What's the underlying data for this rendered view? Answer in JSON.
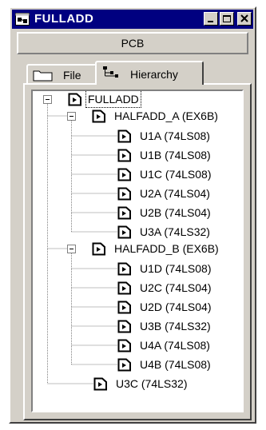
{
  "window": {
    "title": "FULLADD",
    "app_icon": "schematic-app-icon",
    "buttons": [
      "minimize-icon",
      "maximize-icon",
      "close-icon"
    ]
  },
  "pcb_button": {
    "label": "PCB"
  },
  "tabs": [
    {
      "label": "File",
      "icon": "folder-icon",
      "selected": false
    },
    {
      "label": "Hierarchy",
      "icon": "hierarchy-icon",
      "selected": true
    }
  ],
  "tree": {
    "root": {
      "label": "FULLADD",
      "selected": true
    },
    "groups": [
      {
        "label": "HALFADD_A (EX6B)",
        "children": [
          "U1A (74LS08)",
          "U1B (74LS08)",
          "U1C (74LS08)",
          "U2A (74LS04)",
          "U2B (74LS04)",
          "U3A (74LS32)"
        ]
      },
      {
        "label": "HALFADD_B (EX6B)",
        "children": [
          "U1D (74LS08)",
          "U2C (74LS04)",
          "U2D (74LS04)",
          "U3B (74LS32)",
          "U4A (74LS08)",
          "U4B (74LS08)"
        ]
      }
    ],
    "leaf": {
      "label": "U3C (74LS32)"
    }
  }
}
